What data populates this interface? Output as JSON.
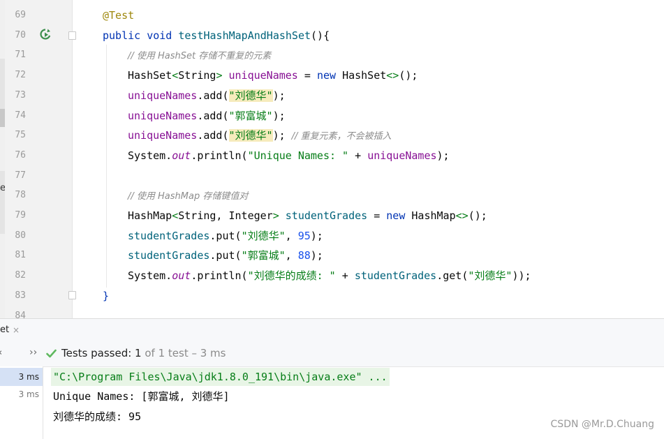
{
  "editor": {
    "line_numbers": [
      "69",
      "70",
      "71",
      "72",
      "73",
      "74",
      "75",
      "76",
      "77",
      "78",
      "79",
      "80",
      "81",
      "82",
      "83",
      "84"
    ],
    "code": {
      "l69": {
        "annotation": "@Test"
      },
      "l70": {
        "kw_public": "public",
        "kw_void": "void",
        "method": "testHashMapAndHashSet",
        "paren": "(){"
      },
      "l71": {
        "comment": "// 使用 HashSet 存储不重复的元素"
      },
      "l72": {
        "type": "HashSet",
        "lt": "<",
        "generic": "String",
        "gt": ">",
        "var": "uniqueNames",
        "eq": " = ",
        "kw_new": "new",
        "ctor": "HashSet",
        "diamond": "<>",
        "end": "();"
      },
      "l73": {
        "var": "uniqueNames",
        "call": ".add(",
        "str": "\"刘德华\"",
        "end": ");"
      },
      "l74": {
        "var": "uniqueNames",
        "call": ".add(",
        "str": "\"郭富城\"",
        "end": ");"
      },
      "l75": {
        "var": "uniqueNames",
        "call": ".add(",
        "str": "\"刘德华\"",
        "end": ");",
        "comment": "// 重复元素，不会被插入"
      },
      "l76": {
        "sys": "System.",
        "out": "out",
        "println": ".println(",
        "str": "\"Unique Names: \"",
        "plus": " + ",
        "var": "uniqueNames",
        "end": ");"
      },
      "l78": {
        "comment": "// 使用 HashMap 存储键值对"
      },
      "l79": {
        "type": "HashMap",
        "lt": "<",
        "generic": "String, Integer",
        "gt": ">",
        "var": "studentGrades",
        "eq": " = ",
        "kw_new": "new",
        "ctor": "HashMap",
        "diamond": "<>",
        "end": "();"
      },
      "l80": {
        "var": "studentGrades",
        "call": ".put(",
        "str": "\"刘德华\"",
        "comma": ", ",
        "num": "95",
        "end": ");"
      },
      "l81": {
        "var": "studentGrades",
        "call": ".put(",
        "str": "\"郭富城\"",
        "comma": ", ",
        "num": "88",
        "end": ");"
      },
      "l82": {
        "sys": "System.",
        "out": "out",
        "println": ".println(",
        "str": "\"刘德华的成绩: \"",
        "plus": " + ",
        "var": "studentGrades",
        "get": ".get(",
        "str2": "\"刘德华\"",
        "end": "));"
      },
      "l83": {
        "brace": "}"
      }
    }
  },
  "tool_window": {
    "tab_label": "et",
    "tab_close": "×",
    "toolbar": {
      "chevron": "‹",
      "more": "››",
      "status_prefix": "Tests passed: ",
      "status_count": "1",
      "status_suffix": " of 1 test – 3 ms"
    },
    "times": [
      "3 ms",
      "3 ms"
    ],
    "console": [
      "\"C:\\Program Files\\Java\\jdk1.8.0_191\\bin\\java.exe\" ...",
      "Unique Names: [郭富城, 刘德华]",
      "刘德华的成绩: 95"
    ]
  },
  "watermark": "CSDN @Mr.D.Chuang",
  "colors": {
    "keyword": "#0033b3",
    "annotation": "#9e880d",
    "string": "#067d17",
    "number": "#1750eb",
    "field": "#871094",
    "comment": "#8c8c8c",
    "string_highlight": "#f6ebbc",
    "pass_green": "#5fb85f"
  }
}
